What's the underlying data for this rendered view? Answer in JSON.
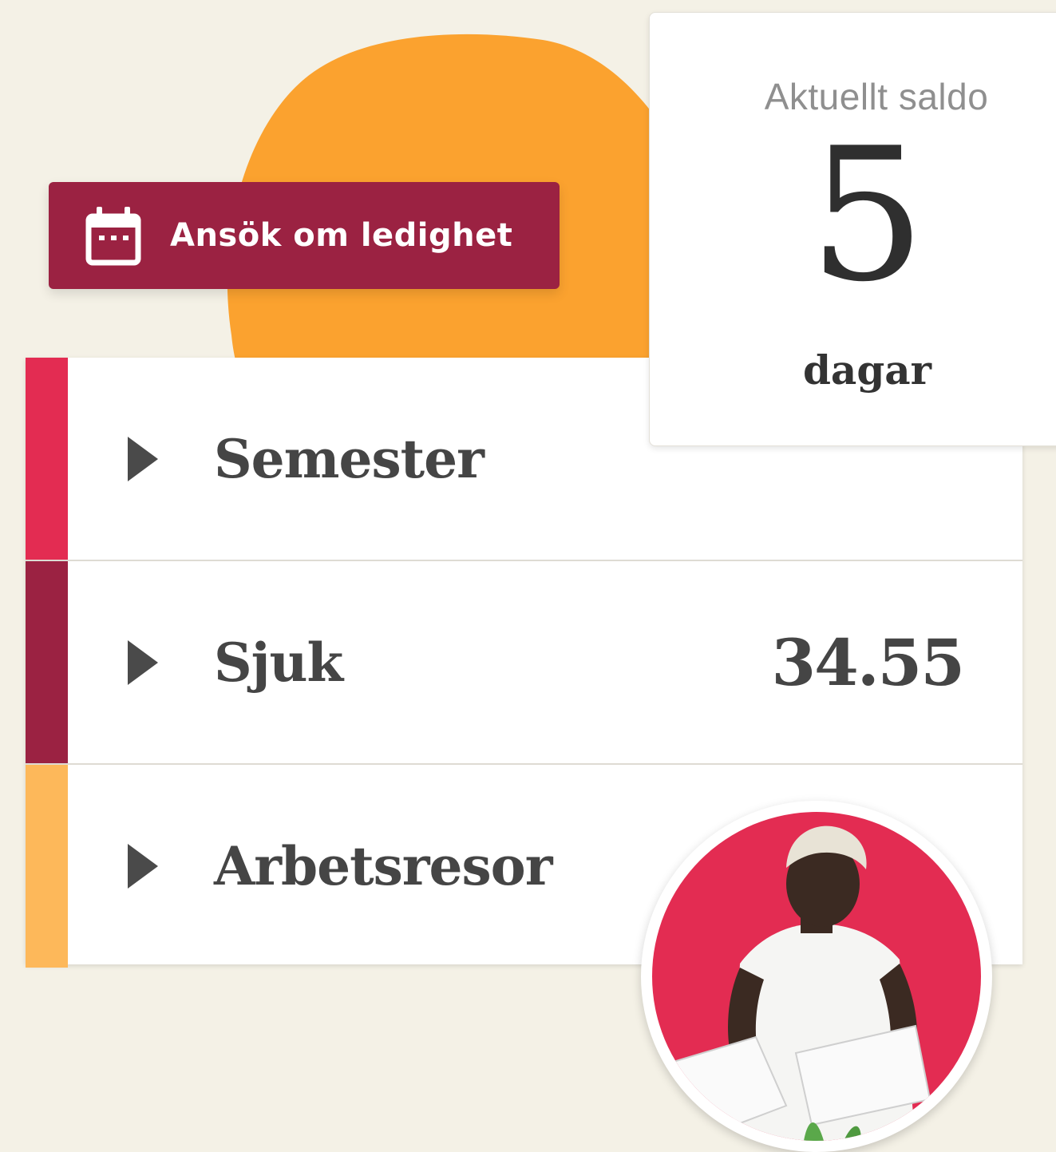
{
  "apply_button": {
    "label": "Ansök om ledighet",
    "icon": "calendar-icon"
  },
  "balance_card": {
    "title": "Aktuellt saldo",
    "value": "5",
    "unit": "dagar"
  },
  "leave_types": [
    {
      "name": "Semester",
      "value": "",
      "color": "#e32c52",
      "icon": "triangle-right-icon"
    },
    {
      "name": "Sjuk",
      "value": "34.55",
      "color": "#9b2242",
      "icon": "triangle-right-icon"
    },
    {
      "name": "Arbetsresor",
      "value": "",
      "color": "#fdb85a",
      "icon": "triangle-right-icon"
    }
  ],
  "colors": {
    "background": "#f4f1e6",
    "accent_orange": "#fba22f",
    "button": "#9b2242",
    "avatar_bg": "#e32c52"
  }
}
